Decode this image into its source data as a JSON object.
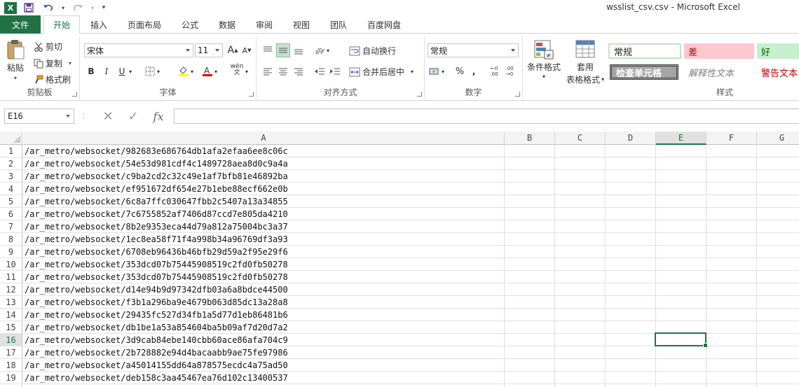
{
  "window": {
    "title": "wsslist_csv.csv - Microsoft Excel",
    "app_icon": "X",
    "accent": "#217346"
  },
  "quick_access": [
    "save-icon",
    "undo-icon",
    "redo-icon",
    "customize-icon"
  ],
  "tabs": [
    {
      "label": "文件"
    },
    {
      "label": "开始"
    },
    {
      "label": "插入"
    },
    {
      "label": "页面布局"
    },
    {
      "label": "公式"
    },
    {
      "label": "数据"
    },
    {
      "label": "审阅"
    },
    {
      "label": "视图"
    },
    {
      "label": "团队"
    },
    {
      "label": "百度网盘"
    }
  ],
  "ribbon": {
    "clipboard": {
      "paste": "粘贴",
      "cut": "剪切",
      "copy": "复制",
      "format_painter": "格式刷",
      "label": "剪贴板"
    },
    "font": {
      "family": "宋体",
      "size": "11",
      "grow": "A",
      "shrink": "A",
      "bold": "B",
      "italic": "I",
      "underline": "U",
      "phonetic": "wén",
      "label": "字体"
    },
    "alignment": {
      "wrap_text": "自动换行",
      "merge_center": "合并后居中",
      "label": "对齐方式"
    },
    "number": {
      "format": "常规",
      "percent": "%",
      "comma": ",",
      "increase_decimal": "←0 .00",
      "decrease_decimal": ".00 →0",
      "label": "数字"
    },
    "styles": {
      "conditional": "条件格式",
      "table_format_1": "套用",
      "table_format_2": "表格格式",
      "normal": "常规",
      "bad": "差",
      "good": "好",
      "check_cell": "检查单元格",
      "explanatory": "解释性文本",
      "warning": "警告文本",
      "label": "样式"
    }
  },
  "formula_bar": {
    "name_box": "E16",
    "cancel": "✕",
    "enter": "✓",
    "fx": "fx",
    "value": ""
  },
  "sheet": {
    "columns": [
      "A",
      "B",
      "C",
      "D",
      "E",
      "F",
      "G"
    ],
    "selected_column": "E",
    "selected_row": 16,
    "rows": [
      {
        "num": "1",
        "a": "/ar_metro/websocket/982683e686764db1afa2efaa6ee8c06c"
      },
      {
        "num": "2",
        "a": "/ar_metro/websocket/54e53d981cdf4c1489728aea8d0c9a4a"
      },
      {
        "num": "3",
        "a": "/ar_metro/websocket/c9ba2cd2c32c49e1af7bfb81e46892ba"
      },
      {
        "num": "4",
        "a": "/ar_metro/websocket/ef951672df654e27b1ebe88ecf662e0b"
      },
      {
        "num": "5",
        "a": "/ar_metro/websocket/6c8a7ffc030647fbb2c5407a13a34855"
      },
      {
        "num": "6",
        "a": "/ar_metro/websocket/7c6755852af7406d87ccd7e805da4210"
      },
      {
        "num": "7",
        "a": "/ar_metro/websocket/8b2e9353eca44d79a812a75004bc3a37"
      },
      {
        "num": "8",
        "a": "/ar_metro/websocket/1ec8ea58f71f4a998b34a96769df3a93"
      },
      {
        "num": "9",
        "a": "/ar_metro/websocket/6708eb96436b46bfb29d59a2f95e29f6"
      },
      {
        "num": "10",
        "a": "/ar_metro/websocket/353dcd07b75445908519c2fd0fb50278"
      },
      {
        "num": "11",
        "a": "/ar_metro/websocket/353dcd07b75445908519c2fd0fb50278"
      },
      {
        "num": "12",
        "a": "/ar_metro/websocket/d14e94b9d97342dfb03a6a8bdce44500"
      },
      {
        "num": "13",
        "a": "/ar_metro/websocket/f3b1a296ba9e4679b063d85dc13a28a8"
      },
      {
        "num": "14",
        "a": "/ar_metro/websocket/29435fc527d34fb1a5d77d1eb86481b6"
      },
      {
        "num": "15",
        "a": "/ar_metro/websocket/db1be1a53a854604ba5b09af7d20d7a2"
      },
      {
        "num": "16",
        "a": "/ar_metro/websocket/3d9cab84ebe140cbb60ace86afa704c9"
      },
      {
        "num": "17",
        "a": "/ar_metro/websocket/2b728882e94d4bacaabb9ae75fe97986"
      },
      {
        "num": "18",
        "a": "/ar_metro/websocket/a45014155dd64a878575ecdc4a75ad50"
      },
      {
        "num": "19",
        "a": "/ar_metro/websocket/deb158c3aa45467ea76d102c13400537"
      }
    ]
  }
}
